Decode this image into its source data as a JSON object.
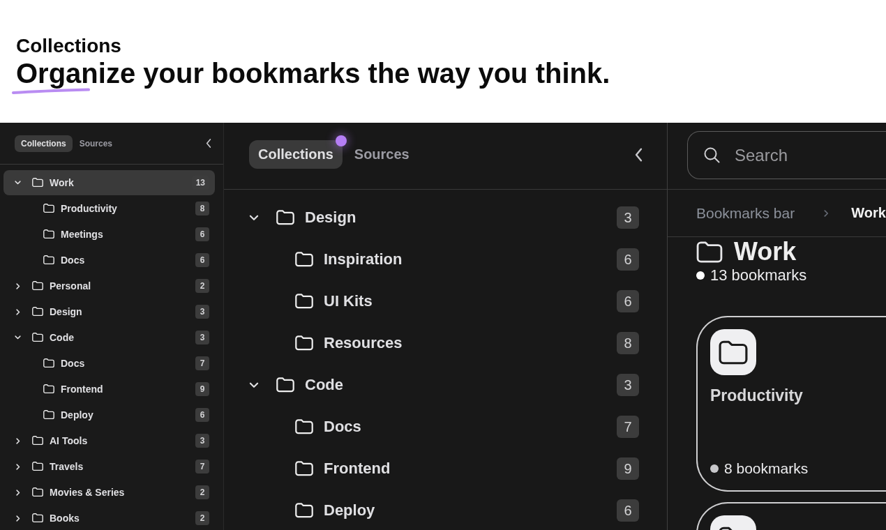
{
  "header": {
    "eyebrow": "Collections",
    "headline": "Organize your bookmarks the way you think."
  },
  "sidebar": {
    "tabs": [
      {
        "label": "Collections",
        "selected": true
      },
      {
        "label": "Sources",
        "selected": false
      }
    ],
    "tree": [
      {
        "label": "Work",
        "count": "13",
        "expanded": true,
        "selected": true,
        "children": [
          {
            "label": "Productivity",
            "count": "8",
            "selected": false
          },
          {
            "label": "Meetings",
            "count": "6",
            "selected": false
          },
          {
            "label": "Docs",
            "count": "6",
            "selected": false
          }
        ]
      },
      {
        "label": "Personal",
        "count": "2",
        "expanded": false,
        "selected": false
      },
      {
        "label": "Design",
        "count": "3",
        "expanded": false,
        "selected": false
      },
      {
        "label": "Code",
        "count": "3",
        "expanded": true,
        "selected": false,
        "children": [
          {
            "label": "Docs",
            "count": "7",
            "selected": false
          },
          {
            "label": "Frontend",
            "count": "9",
            "selected": false
          },
          {
            "label": "Deploy",
            "count": "6",
            "selected": false
          }
        ]
      },
      {
        "label": "AI Tools",
        "count": "3",
        "expanded": false,
        "selected": false
      },
      {
        "label": "Travels",
        "count": "7",
        "expanded": false,
        "selected": false
      },
      {
        "label": "Movies & Series",
        "count": "2",
        "expanded": false,
        "selected": false
      },
      {
        "label": "Books",
        "count": "2",
        "expanded": false,
        "selected": false
      }
    ]
  },
  "panel": {
    "tabs": [
      {
        "label": "Collections",
        "selected": true
      },
      {
        "label": "Sources",
        "selected": false
      }
    ],
    "tree": [
      {
        "label": "Design",
        "count": "3",
        "expanded": true,
        "selected": false,
        "children": [
          {
            "label": "Inspiration",
            "count": "6",
            "selected": false
          },
          {
            "label": "UI Kits",
            "count": "6",
            "selected": false
          },
          {
            "label": "Resources",
            "count": "8",
            "selected": false
          }
        ]
      },
      {
        "label": "Code",
        "count": "3",
        "expanded": true,
        "selected": false,
        "children": [
          {
            "label": "Docs",
            "count": "7",
            "selected": false
          },
          {
            "label": "Frontend",
            "count": "9",
            "selected": false
          },
          {
            "label": "Deploy",
            "count": "6",
            "selected": false
          }
        ]
      }
    ]
  },
  "detail": {
    "search": {
      "placeholder": "Search"
    },
    "breadcrumb": [
      {
        "label": "Bookmarks bar",
        "kind": "link"
      },
      {
        "label": "Work",
        "kind": "current"
      }
    ],
    "title": "Work",
    "count": "13 bookmarks",
    "cards": [
      {
        "kind": "folder",
        "name": "Productivity",
        "count": "8 bookmarks"
      },
      {
        "kind": "folder"
      }
    ]
  }
}
